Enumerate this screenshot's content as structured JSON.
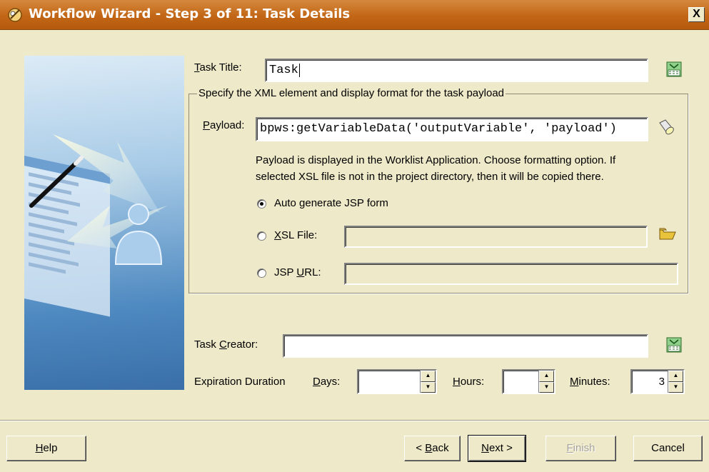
{
  "window": {
    "title": "Workflow Wizard - Step 3 of 11: Task Details",
    "close_glyph": "X"
  },
  "task_title": {
    "label_pre": "",
    "label_key": "T",
    "label_post": "ask Title:",
    "value": "Task"
  },
  "payload_group": {
    "title": "Specify the XML element and display format for the task payload",
    "payload_label_key": "P",
    "payload_label_post": "ayload:",
    "payload_value": "bpws:getVariableData('outputVariable', 'payload')",
    "description_line1": "Payload is displayed in the Worklist Application. Choose formatting option. If",
    "description_line2": "selected XSL file is not in the project directory, then it will be copied there.",
    "options": {
      "auto_jsp": {
        "label": "Auto generate JSP form",
        "selected": true
      },
      "xsl_file": {
        "label_key": "X",
        "label_post": "SL File:",
        "value": "",
        "selected": false
      },
      "jsp_url": {
        "label_pre": "JSP ",
        "label_key": "U",
        "label_post": "RL:",
        "value": "",
        "selected": false
      }
    }
  },
  "task_creator": {
    "label_pre": "Task ",
    "label_key": "C",
    "label_post": "reator:",
    "value": ""
  },
  "expiration": {
    "label": "Expiration Duration",
    "days": {
      "label_key": "D",
      "label_post": "ays:",
      "value": ""
    },
    "hours": {
      "label_key": "H",
      "label_post": "ours:",
      "value": ""
    },
    "minutes": {
      "label_key": "M",
      "label_post": "inutes:",
      "value": "3"
    }
  },
  "buttons": {
    "help": {
      "key": "H",
      "post": "elp"
    },
    "back": {
      "pre": "< ",
      "key": "B",
      "post": "ack"
    },
    "next": {
      "key": "N",
      "post": "ext >"
    },
    "finish": {
      "key": "F",
      "post": "inish",
      "enabled": false
    },
    "cancel": {
      "label": "Cancel"
    }
  },
  "colors": {
    "titlebar": "#c26616",
    "dialog_bg": "#eee9c8",
    "panel_blue": "#4e89c0"
  },
  "icons": [
    "workflow-wizard-icon",
    "expression-builder-icon",
    "xpath-flashlight-icon",
    "folder-browse-icon",
    "dialog-close-icon"
  ]
}
